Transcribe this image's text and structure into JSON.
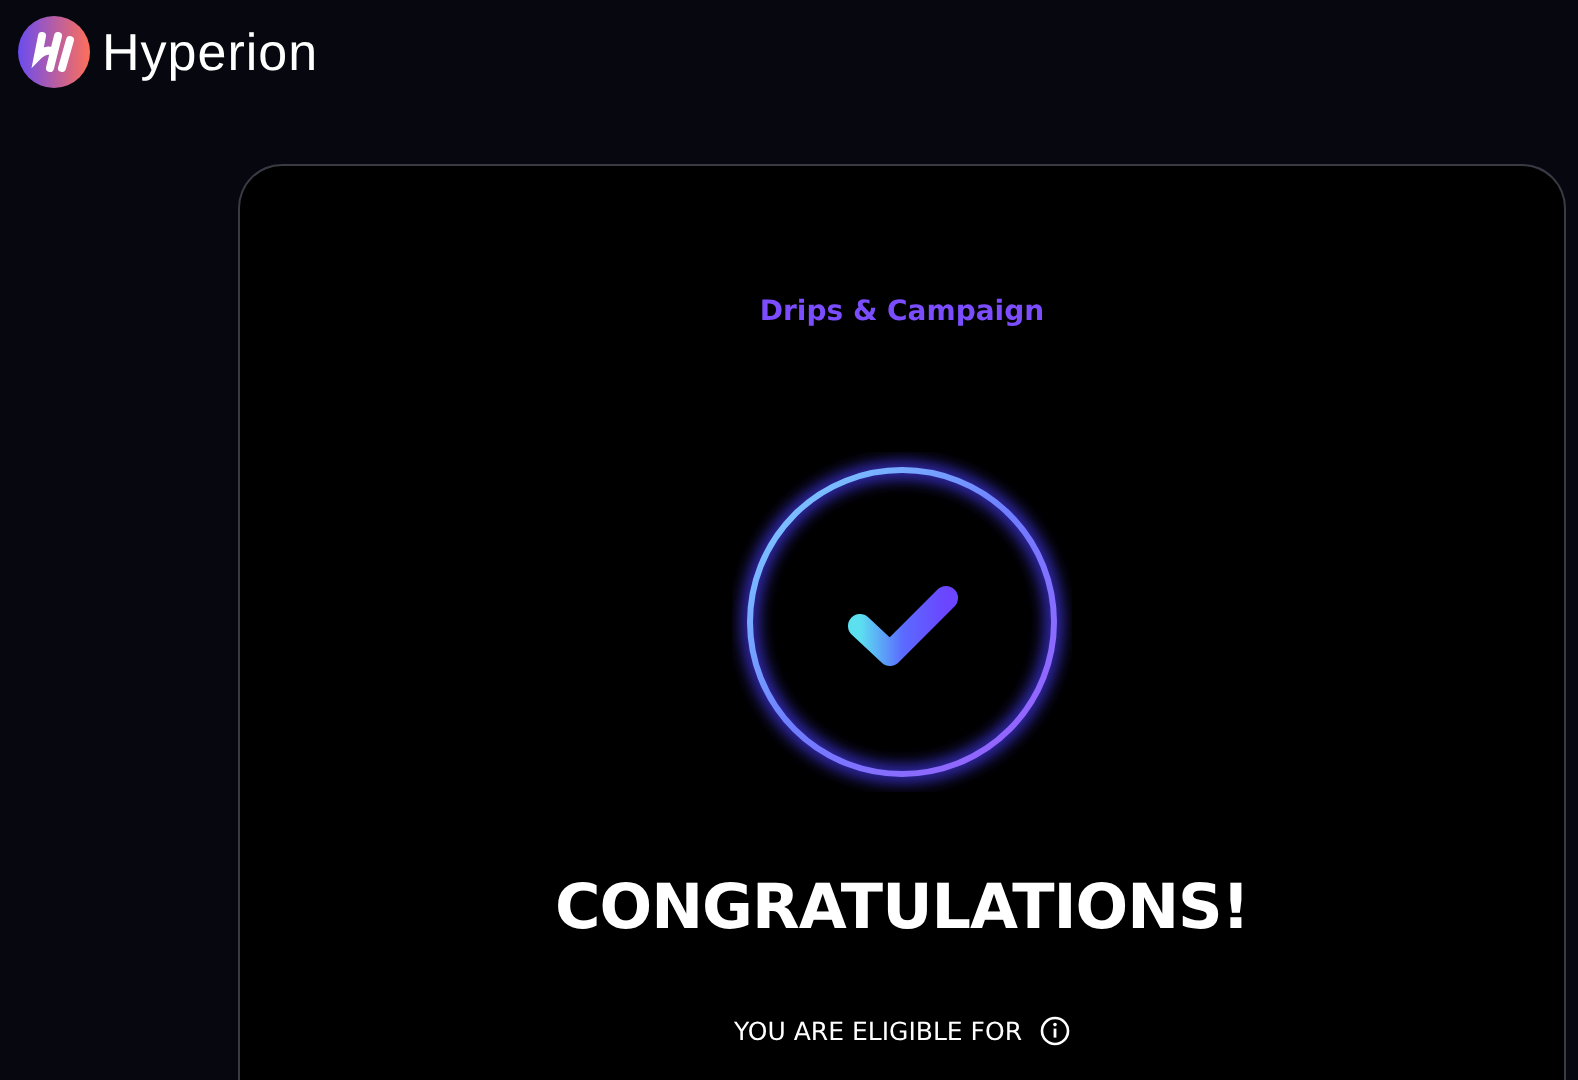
{
  "brand": {
    "name": "Hyperion"
  },
  "card": {
    "category": "Drips & Campaign",
    "headline": "CONGRATULATIONS!",
    "eligibility": "YOU ARE ELIGIBLE FOR"
  }
}
